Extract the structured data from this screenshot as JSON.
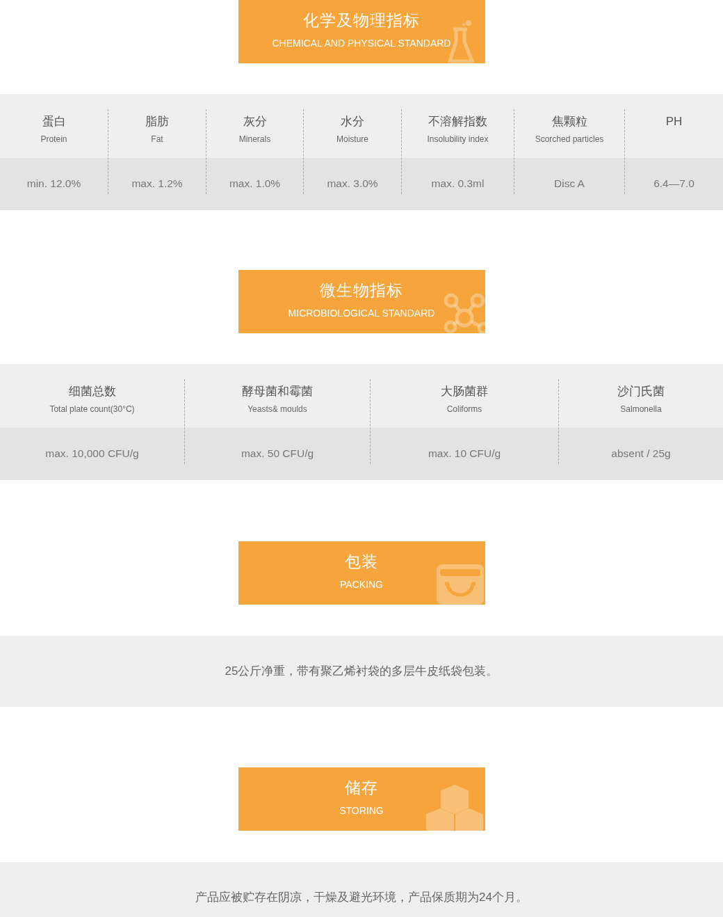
{
  "sections": [
    {
      "banner": {
        "title_cn": "化学及物理指标",
        "title_en": "CHEMICAL AND PHYSICAL STANDARD"
      },
      "kind": "table",
      "columns": [
        {
          "name_cn": "蛋白",
          "name_en": "Protein",
          "value": "min. 12.0%"
        },
        {
          "name_cn": "脂肪",
          "name_en": "Fat",
          "value": "max. 1.2%"
        },
        {
          "name_cn": "灰分",
          "name_en": "Minerals",
          "value": "max. 1.0%"
        },
        {
          "name_cn": "水分",
          "name_en": "Moisture",
          "value": "max. 3.0%"
        },
        {
          "name_cn": "不溶解指数",
          "name_en": "Insolubility index",
          "value": "max. 0.3ml"
        },
        {
          "name_cn": "焦颗粒",
          "name_en": "Scorched particles",
          "value": "Disc A"
        },
        {
          "name_cn": "PH",
          "value": "6.4—7.0"
        }
      ]
    },
    {
      "banner": {
        "title_cn": "微生物指标",
        "title_en": "MICROBIOLOGICAL STANDARD"
      },
      "kind": "table",
      "columns": [
        {
          "name_cn": "细菌总数",
          "name_en": "Total plate count(30°C)",
          "value": "max. 10,000 CFU/g"
        },
        {
          "name_cn": "酵母菌和霉菌",
          "name_en": "Yeasts& moulds",
          "value": "max. 50 CFU/g"
        },
        {
          "name_cn": "大肠菌群",
          "name_en": "Coliforms",
          "value": "max. 10 CFU/g"
        },
        {
          "name_cn": "沙门氏菌",
          "name_en": "Salmonella",
          "value": "absent / 25g"
        }
      ]
    },
    {
      "banner": {
        "title_cn": "包装",
        "title_en": "PACKING"
      },
      "kind": "text",
      "text": "25公斤净重，带有聚乙烯衬袋的多层牛皮纸袋包装。"
    },
    {
      "banner": {
        "title_cn": "储存",
        "title_en": "STORING"
      },
      "kind": "text",
      "text": "产品应被贮存在阴凉，干燥及避光环境，产品保质期为24个月。"
    }
  ]
}
